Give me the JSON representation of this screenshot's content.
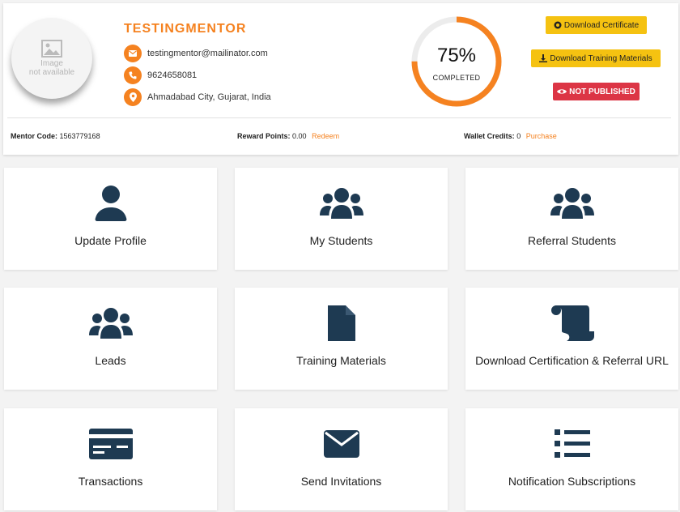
{
  "profile": {
    "avatar_text_line1": "Image",
    "avatar_text_line2": "not available",
    "name": "TESTINGMENTOR",
    "email": "testingmentor@mailinator.com",
    "phone": "9624658081",
    "location": "Ahmadabad City, Gujarat, India"
  },
  "progress": {
    "value": 75,
    "percent_text": "75%",
    "label": "COMPLETED"
  },
  "actions": {
    "download_certificate": "Download Certificate",
    "download_training": "Download Training Materials",
    "not_published": "NOT PUBLISHED"
  },
  "stats": {
    "mentor_code_label": "Mentor Code:",
    "mentor_code_value": "1563779168",
    "reward_label": "Reward Points:",
    "reward_value": "0.00",
    "redeem": "Redeem",
    "wallet_label": "Wallet Credits:",
    "wallet_value": "0",
    "purchase": "Purchase"
  },
  "colors": {
    "accent": "#f58220",
    "icon": "#1e3a52",
    "yellow": "#f5c211",
    "red": "#dc3545"
  },
  "tiles": [
    {
      "label": "Update Profile",
      "icon": "user-icon"
    },
    {
      "label": "My Students",
      "icon": "users-icon"
    },
    {
      "label": "Referral Students",
      "icon": "users-icon"
    },
    {
      "label": "Leads",
      "icon": "users-icon"
    },
    {
      "label": "Training Materials",
      "icon": "file-icon"
    },
    {
      "label": "Download Certification & Referral URL",
      "icon": "scroll-icon"
    },
    {
      "label": "Transactions",
      "icon": "credit-card-icon"
    },
    {
      "label": "Send Invitations",
      "icon": "envelope-icon"
    },
    {
      "label": "Notification Subscriptions",
      "icon": "list-icon"
    }
  ]
}
